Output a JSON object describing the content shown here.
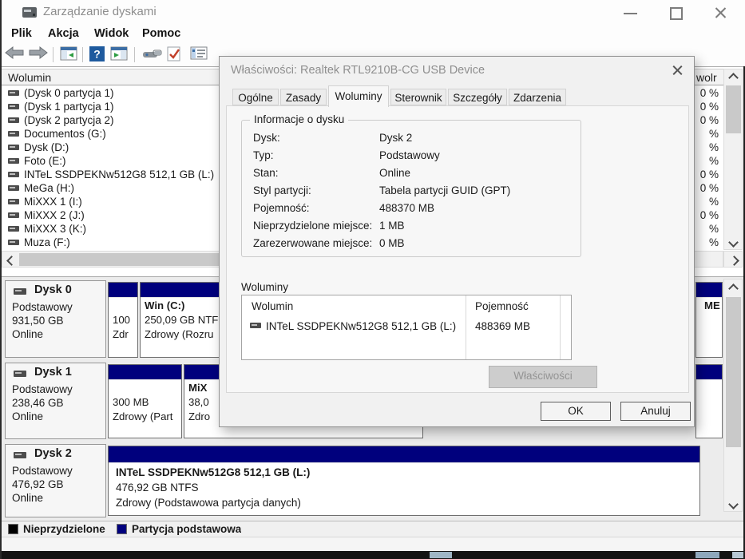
{
  "window": {
    "title": "Zarządzanie dyskami",
    "menu": [
      "Plik",
      "Akcja",
      "Widok",
      "Pomoc"
    ]
  },
  "toolbar_icons": [
    "back",
    "forward",
    "show-console-tree",
    "help",
    "show-action-pane",
    "console-snapin",
    "task-check",
    "properties-list"
  ],
  "volume_list": {
    "column_header": "Wolumin",
    "free_pct_header": "wolr",
    "items": [
      {
        "label": "(Dysk 0 partycja 1)",
        "free_pct": "0 %"
      },
      {
        "label": "(Dysk 1 partycja 1)",
        "free_pct": "0 %"
      },
      {
        "label": "(Dysk 2 partycja 2)",
        "free_pct": "0 %"
      },
      {
        "label": "Documentos (G:)",
        "free_pct": "%"
      },
      {
        "label": "Dysk (D:)",
        "free_pct": "%"
      },
      {
        "label": "Foto (E:)",
        "free_pct": "%"
      },
      {
        "label": "INTeL SSDPEKNw512G8 512,1 GB (L:)",
        "free_pct": "0 %"
      },
      {
        "label": "MeGa (H:)",
        "free_pct": "0 %"
      },
      {
        "label": "MiXXX 1 (I:)",
        "free_pct": "%"
      },
      {
        "label": "MiXXX 2 (J:)",
        "free_pct": "0 %"
      },
      {
        "label": "MiXXX 3 (K:)",
        "free_pct": "%"
      },
      {
        "label": "Muza (F:)",
        "free_pct": "%"
      }
    ]
  },
  "disks": [
    {
      "name": "Dysk 0",
      "type": "Podstawowy",
      "size": "931,50 GB",
      "status": "Online",
      "partitions": [
        {
          "title": "",
          "line1": "100",
          "line2": "Zdr"
        },
        {
          "title": "Win  (C:)",
          "line1": "250,09 GB NTF",
          "line2": "Zdrowy (Rozru"
        },
        {
          "title": "ME",
          "line1": "",
          "line2": ""
        }
      ]
    },
    {
      "name": "Dysk 1",
      "type": "Podstawowy",
      "size": "238,46 GB",
      "status": "Online",
      "partitions": [
        {
          "title": "",
          "line1": "300 MB",
          "line2": "Zdrowy (Part"
        },
        {
          "title": "MiX",
          "line1": "38,0",
          "line2": "Zdro"
        },
        {
          "title": "",
          "line1": "",
          "line2": ""
        }
      ]
    },
    {
      "name": "Dysk 2",
      "type": "Podstawowy",
      "size": "476,92 GB",
      "status": "Online",
      "partitions": [
        {
          "title": "INTeL SSDPEKNw512G8 512,1 GB  (L:)",
          "line1": "476,92 GB NTFS",
          "line2": "Zdrowy (Podstawowa partycja danych)"
        }
      ]
    }
  ],
  "legend": {
    "items": [
      {
        "label": "Nieprzydzielone",
        "color": "#000000"
      },
      {
        "label": "Partycja podstawowa",
        "color": "#00007d"
      }
    ]
  },
  "dialog": {
    "title": "Właściwości: Realtek RTL9210B-CG USB Device",
    "tabs": [
      "Ogólne",
      "Zasady",
      "Woluminy",
      "Sterownik",
      "Szczegóły",
      "Zdarzenia"
    ],
    "active_tab": "Woluminy",
    "disk_info": {
      "group_title": "Informacje o dysku",
      "rows": [
        {
          "label": "Dysk:",
          "value": "Dysk 2"
        },
        {
          "label": "Typ:",
          "value": "Podstawowy"
        },
        {
          "label": "Stan:",
          "value": "Online"
        },
        {
          "label": "Styl partycji:",
          "value": "Tabela partycji GUID (GPT)"
        },
        {
          "label": "Pojemność:",
          "value": "488370 MB"
        },
        {
          "label": "Nieprzydzielone miejsce:",
          "value": "1 MB"
        },
        {
          "label": "Zarezerwowane miejsce:",
          "value": "0 MB"
        }
      ]
    },
    "volumes": {
      "section_label": "Woluminy",
      "col_volume": "Wolumin",
      "col_capacity": "Pojemność",
      "rows": [
        {
          "volume": "INTeL SSDPEKNw512G8 512,1 GB (L:)",
          "capacity": "488369 MB"
        }
      ],
      "properties_button": "Właściwości"
    },
    "ok_button": "OK",
    "cancel_button": "Anuluj"
  },
  "colors": {
    "partition_primary": "#00007d",
    "unallocated": "#000000"
  }
}
